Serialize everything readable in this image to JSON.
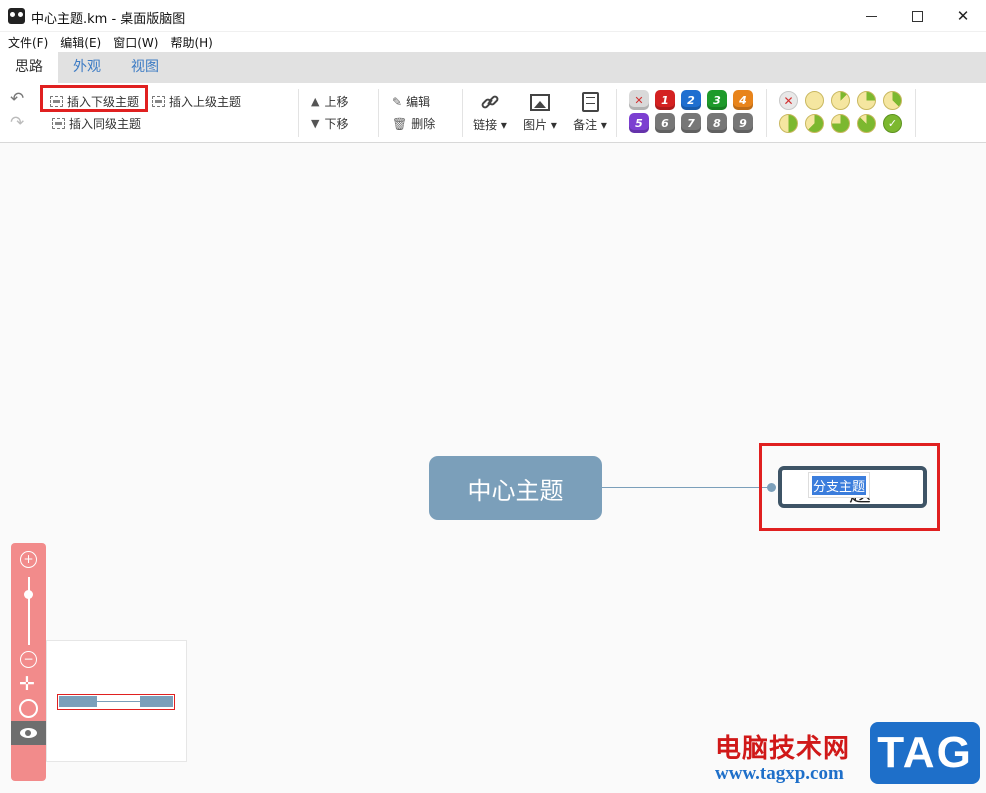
{
  "window": {
    "title": "中心主题.km - 桌面版脑图",
    "minimize_icon": "minimize-icon",
    "maximize_icon": "maximize-icon",
    "close_label": "✕"
  },
  "menubar": [
    {
      "label": "文件(F)"
    },
    {
      "label": "编辑(E)"
    },
    {
      "label": "窗口(W)"
    },
    {
      "label": "帮助(H)"
    }
  ],
  "tabs": [
    {
      "label": "思路",
      "active": true
    },
    {
      "label": "外观",
      "active": false
    },
    {
      "label": "视图",
      "active": false
    }
  ],
  "ribbon": {
    "insert_child": "插入下级主题",
    "insert_parent": "插入上级主题",
    "insert_sibling": "插入同级主题",
    "move_up": "上移",
    "move_down": "下移",
    "edit": "编辑",
    "delete": "删除",
    "link": "链接",
    "image": "图片",
    "note": "备注",
    "priority": [
      {
        "label": "✕",
        "color": "#d9d9d9",
        "text": "#d23030"
      },
      {
        "label": "1",
        "color": "#d42121"
      },
      {
        "label": "2",
        "color": "#1f6fd0"
      },
      {
        "label": "3",
        "color": "#1e9a2a"
      },
      {
        "label": "4",
        "color": "#e8841b"
      },
      {
        "label": "5",
        "color": "#7c3fd1"
      },
      {
        "label": "6",
        "color": "#777777"
      },
      {
        "label": "7",
        "color": "#777777"
      },
      {
        "label": "8",
        "color": "#777777"
      },
      {
        "label": "9",
        "color": "#777777"
      }
    ],
    "progress": [
      0,
      0,
      0.125,
      0.25,
      0.375,
      0.5,
      0.625,
      0.75,
      0.875,
      1
    ]
  },
  "mindmap": {
    "root": "中心主题",
    "branch_editing": "分支主题",
    "branch_ghost": "题"
  },
  "zoom_panel": {
    "zoom_in": "+",
    "zoom_out": "−",
    "move": "✛"
  },
  "watermark": {
    "text": "电脑技术网",
    "url": "www.tagxp.com",
    "badge": "TAG"
  }
}
